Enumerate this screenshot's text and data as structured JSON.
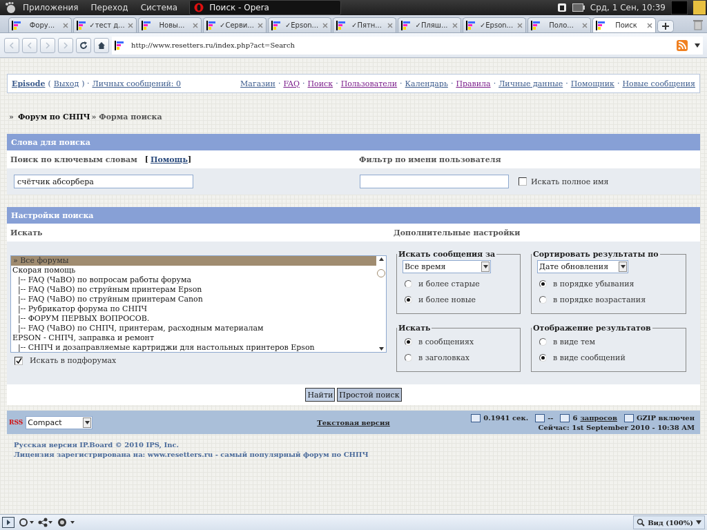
{
  "desktop_panel": {
    "menus": [
      "Приложения",
      "Переход",
      "Система"
    ],
    "window_title": "Поиск - Opera",
    "clock": "Срд,  1 Сен, 10:39"
  },
  "tabs": [
    {
      "label": "Фору...",
      "selected": false
    },
    {
      "label": "✓тест д...",
      "selected": false
    },
    {
      "label": "Новы...",
      "selected": false
    },
    {
      "label": "✓Серви...",
      "selected": false
    },
    {
      "label": "✓Epson...",
      "selected": false
    },
    {
      "label": "✓Пятн...",
      "selected": false
    },
    {
      "label": "✓Пляш...",
      "selected": false
    },
    {
      "label": "✓Epson...",
      "selected": false
    },
    {
      "label": "Поло...",
      "selected": false
    },
    {
      "label": "Поиск",
      "selected": true
    }
  ],
  "address": "http://www.resetters.ru/index.php?act=Search",
  "userbar": {
    "user": "Episode",
    "open": "(",
    "logout": "Выход",
    "close": ") ·",
    "messages": "Личных сообщений: 0"
  },
  "nav_separator": "·",
  "nav": [
    {
      "label": "Магазин",
      "visited": false
    },
    {
      "label": "FAQ",
      "visited": true
    },
    {
      "label": "Поиск",
      "visited": true
    },
    {
      "label": "Пользователи",
      "visited": true
    },
    {
      "label": "Календарь",
      "visited": false
    },
    {
      "label": "Правила",
      "visited": true
    },
    {
      "label": "Личные данные",
      "visited": false
    },
    {
      "label": "Помощник",
      "visited": false
    },
    {
      "label": "Новые сообщения",
      "visited": false
    }
  ],
  "breadcrumb": {
    "marker": "»",
    "forum": "Форум по СНПЧ",
    "current": "» Форма поиска"
  },
  "words_section": {
    "title": "Слова для поиска",
    "keyword_label": "Поиск по ключевым словам",
    "help_open": "[",
    "help": "Помощь",
    "help_close": "]",
    "user_label": "Фильтр по имени пользователя",
    "keyword_value": "счётчик абсорбера",
    "full_name": {
      "label": "Искать полное имя",
      "checked": false
    }
  },
  "settings_section": {
    "title": "Настройки поиска",
    "search_label": "Искать",
    "extra_label": "Дополнительные настройки",
    "forums": [
      {
        "label": "» Все форумы",
        "selected": true
      },
      {
        "label": "Скорая помощь",
        "selected": false,
        "children": [
          {
            "label": "|-- FAQ (ЧаВО) по вопросам работы форума",
            "selected": false
          },
          {
            "label": "|-- FAQ (ЧаВО) по струйным принтерам Epson",
            "selected": false
          },
          {
            "label": "|-- FAQ (ЧаВО) по струйным принтерам Canon",
            "selected": false
          },
          {
            "label": "|-- Рубрикатор форума по СНПЧ",
            "selected": false
          },
          {
            "label": "|-- ФОРУМ ПЕРВЫХ ВОПРОСОВ.",
            "selected": false
          },
          {
            "label": "|-- FAQ (ЧаВО) по СНПЧ, принтерам, расходным материалам",
            "selected": false
          }
        ]
      },
      {
        "label": "EPSON - СНПЧ, заправка и ремонт",
        "selected": false,
        "children": [
          {
            "label": "|-- СНПЧ и дозаправляемые картриджи для настольных принтеров Epson",
            "selected": false
          }
        ]
      }
    ],
    "subforums": {
      "label": "Искать в подфорумах",
      "checked": true
    },
    "groups": [
      {
        "legend": "Искать сообщения за",
        "select": "Все время",
        "options": [
          {
            "label": "и более старые",
            "selected": false
          },
          {
            "label": "и более новые",
            "selected": true
          }
        ]
      },
      {
        "legend": "Сортировать результаты по",
        "select": "Дате обновления",
        "options": [
          {
            "label": "в порядке убывания",
            "selected": true
          },
          {
            "label": "в порядке возрастания",
            "selected": false
          }
        ]
      },
      {
        "legend": "Искать",
        "options": [
          {
            "label": "в сообщениях",
            "selected": true
          },
          {
            "label": "в заголовках",
            "selected": false
          }
        ]
      },
      {
        "legend": "Отображение результатов",
        "options": [
          {
            "label": "в виде тем",
            "selected": false
          },
          {
            "label": "в виде сообщений",
            "selected": true
          }
        ]
      }
    ]
  },
  "buttons": [
    "Найти",
    "Простой поиск"
  ],
  "footer": {
    "rss": "RSS",
    "skin": "Compact",
    "text_version": "Текстовая версия",
    "time": "0.1941 сек.",
    "load": "--",
    "queries_count": "6",
    "queries": "запросов",
    "gzip": "GZIP включен",
    "now": "Сейчас: 1st September 2010 - 10:38 AM"
  },
  "copyright": [
    "Русская версия IP.Board © 2010  IPS, Inc.",
    "Лицензия зарегистрирована на: www.resetters.ru - самый популярный форум по СНПЧ"
  ],
  "browser_status": {
    "zoom": "Вид (100%)"
  }
}
